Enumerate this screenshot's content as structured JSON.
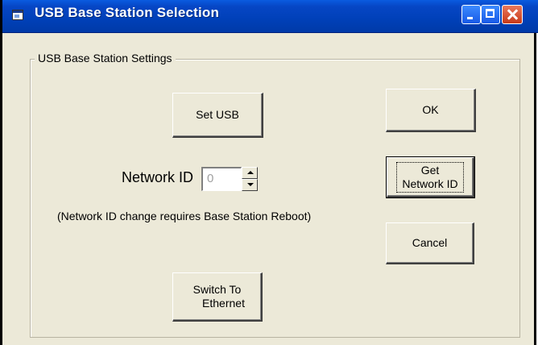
{
  "window": {
    "title": "USB Base Station Selection",
    "controls": [
      "minimize",
      "maximize",
      "close"
    ]
  },
  "group": {
    "label": "USB Base Station Settings"
  },
  "buttons": {
    "set_usb": "Set USB",
    "ok": "OK",
    "get_network_id_line1": "Get",
    "get_network_id_line2": "Network ID",
    "cancel": "Cancel",
    "switch_line1": "Switch To",
    "switch_line2": "Ethernet"
  },
  "network": {
    "label": "Network ID",
    "value": "0",
    "note": "(Network ID change requires Base Station Reboot)"
  },
  "colors": {
    "titlebar": "#0040B8",
    "face": "#ECE9D8",
    "close": "#C83A18"
  },
  "icons": [
    "app-window-icon",
    "minimize-icon",
    "maximize-icon",
    "close-icon",
    "spin-up-icon",
    "spin-down-icon"
  ]
}
